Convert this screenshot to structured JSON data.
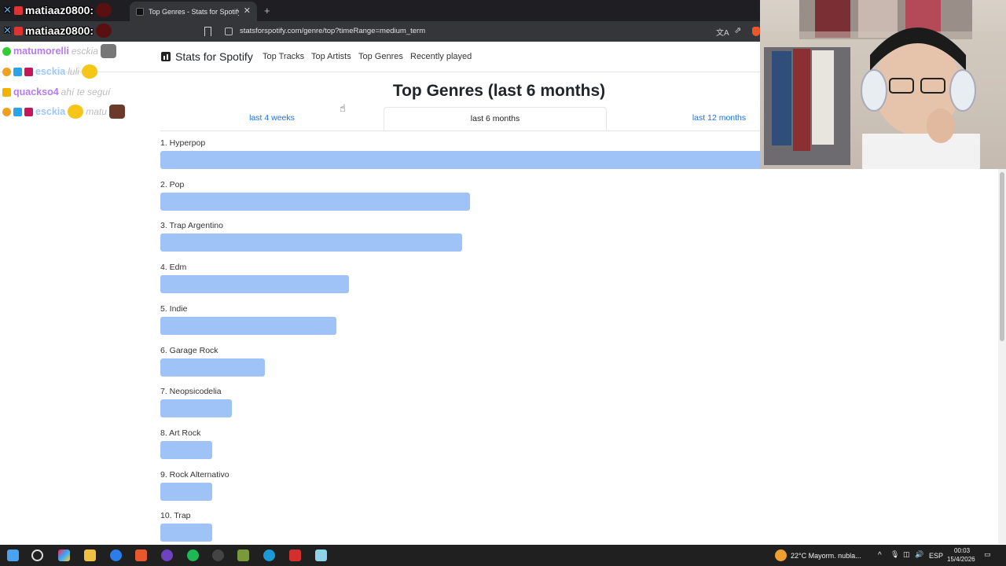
{
  "browser": {
    "tab_title": "Top Genres - Stats for Spotify",
    "close_glyph": "✕",
    "new_tab_glyph": "+",
    "url": "statsforspotify.com/genre/top?timeRange=medium_term"
  },
  "site": {
    "brand": "Stats for Spotify",
    "nav": [
      "Top Tracks",
      "Top Artists",
      "Top Genres",
      "Recently played"
    ],
    "title": "Top Genres (last 6 months)",
    "range_tabs": [
      "last 4 weeks",
      "last 6 months",
      "last 12 months"
    ],
    "active_range": "last 6 months",
    "bar_color": "#a0c3f7",
    "link_color": "#1a73e8"
  },
  "chart_data": {
    "type": "bar",
    "orientation": "horizontal",
    "categories": [
      "1. Hyperpop",
      "2. Pop",
      "3. Trap Argentino",
      "4. Edm",
      "5. Indie",
      "6. Garage Rock",
      "7. Neopsicodelia",
      "8. Art Rock",
      "9. Rock Alternativo",
      "10. Trap"
    ],
    "values": [
      100,
      37,
      36,
      22.5,
      21,
      12.5,
      8.5,
      6.2,
      6.2,
      6.2
    ],
    "value_unit": "percent of top genre (bar fill)",
    "xlabel": "",
    "ylabel": "",
    "grid": false
  },
  "chat": {
    "lines": [
      {
        "name": "matumorelli",
        "message": "esckia",
        "name_color": "#b57cf0"
      },
      {
        "name": "esckia",
        "message": "luli",
        "name_color": "#9ec6ff"
      },
      {
        "name": "quackso4",
        "message": "ahí te seguí",
        "name_color": "#b57cf0"
      },
      {
        "name": "esckia",
        "message": "matu",
        "name_color": "#9ec6ff"
      }
    ],
    "alerts": [
      "matiaaz0800:",
      "matiaaz0800:"
    ]
  },
  "taskbar": {
    "weather": "22°C  Mayorm. nubla...",
    "language": "ESP",
    "time": "00:03",
    "date": "15/4/2026"
  }
}
